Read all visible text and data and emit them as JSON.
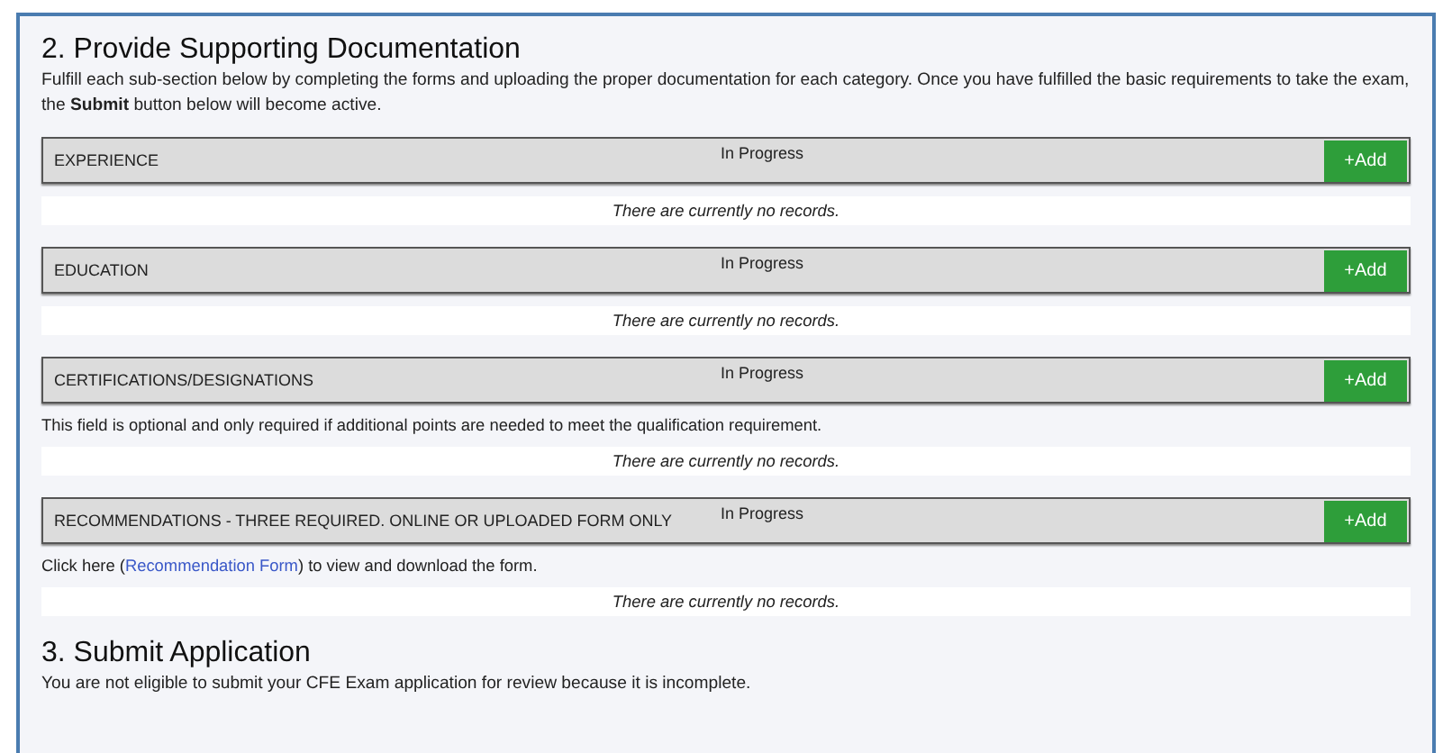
{
  "sections": [
    {
      "heading": "2. Provide Supporting Documentation",
      "intro": "Fulfill each sub-section below by completing the forms and uploading the proper documentation for each category. Once you have fulfilled the basic requirements to take the exam, the **Submit** button below will become active.",
      "categories": [
        {
          "title": "EXPERIENCE",
          "status": "In Progress",
          "button": "+Add",
          "records": "There are currently no records."
        },
        {
          "title": "EDUCATION",
          "status": "In Progress",
          "button": "+Add",
          "records": "There are currently no records."
        },
        {
          "title": "CERTIFICATIONS/DESIGNATIONS",
          "status": "In Progress",
          "button": "+Add",
          "note": {
            "text": "This field is optional and only required if additional points are needed to meet the qualification requirement."
          },
          "records": "There are currently no records."
        },
        {
          "title": "RECOMMENDATIONS - THREE REQUIRED. ONLINE OR UPLOADED FORM ONLY",
          "status": "In Progress",
          "button": "+Add",
          "note": {
            "text": "Click here (",
            "link": "Recommendation Form",
            "after": ") to view and download the form."
          },
          "records": "There are currently no records."
        }
      ]
    },
    {
      "heading": "3. Submit Application",
      "intro": "You are not eligible to submit your CFE Exam application for review because it is incomplete."
    }
  ]
}
